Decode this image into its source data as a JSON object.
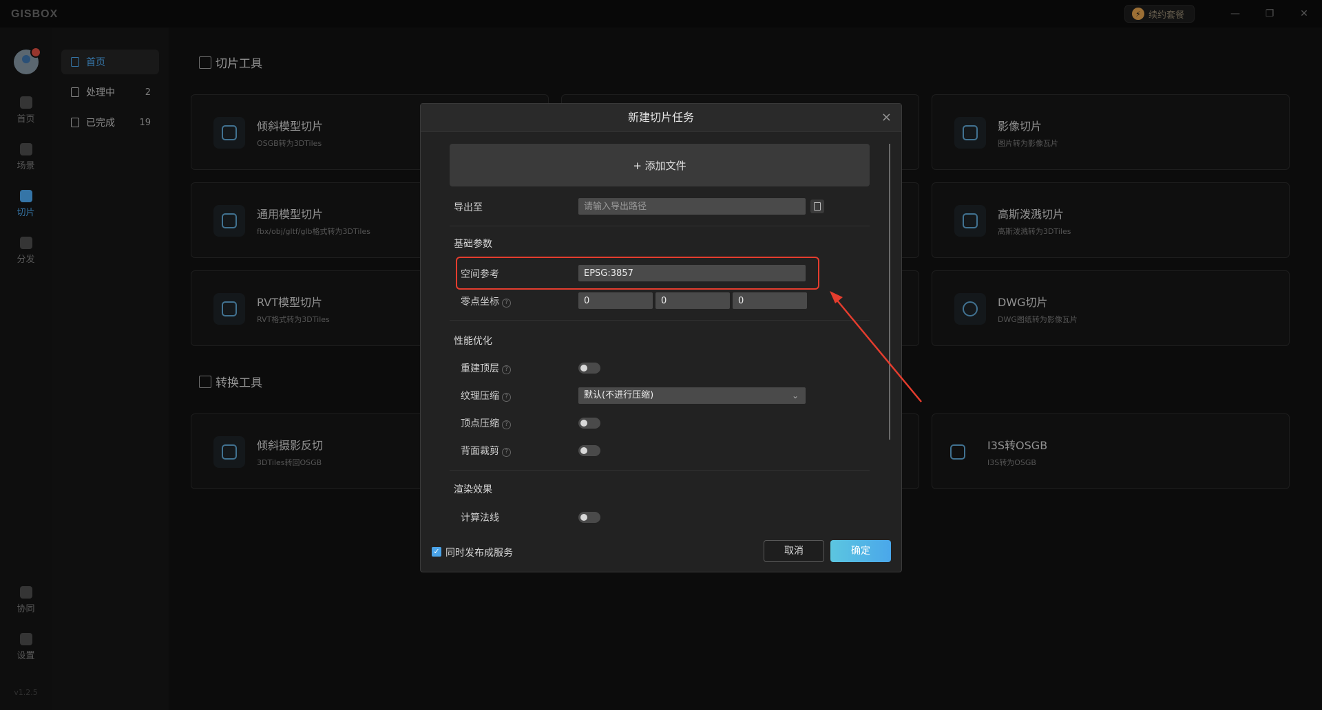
{
  "app": {
    "logo": "GISBOX",
    "renew_label": "续约套餐",
    "version": "v1.2.5"
  },
  "window_controls": {
    "minimize": "—",
    "maximize": "❐",
    "close": "✕"
  },
  "rail": {
    "items": [
      {
        "label": "首页"
      },
      {
        "label": "场景"
      },
      {
        "label": "切片"
      },
      {
        "label": "分发"
      },
      {
        "label": "协同"
      },
      {
        "label": "设置"
      }
    ],
    "active": "切片"
  },
  "subnav": {
    "items": [
      {
        "label": "首页",
        "count": ""
      },
      {
        "label": "处理中",
        "count": "2"
      },
      {
        "label": "已完成",
        "count": "19"
      }
    ]
  },
  "sections": {
    "slice_tools": "切片工具",
    "convert_tools": "转换工具"
  },
  "cards": {
    "oblique": {
      "title": "倾斜模型切片",
      "sub": "OSGB转为3DTiles"
    },
    "generic": {
      "title": "通用模型切片",
      "sub": "fbx/obj/gltf/glb格式转为3DTiles"
    },
    "rvt": {
      "title": "RVT模型切片",
      "sub": "RVT格式转为3DTiles"
    },
    "image": {
      "title": "影像切片",
      "sub": "图片转为影像瓦片"
    },
    "gaussian": {
      "title": "高斯泼溅切片",
      "sub": "高斯泼溅转为3DTiles"
    },
    "dwg": {
      "title": "DWG切片",
      "sub": "DWG图纸转为影像瓦片"
    },
    "reverse": {
      "title": "倾斜摄影反切",
      "sub": "3DTiles转回OSGB"
    },
    "i3s": {
      "title": "I3S转OSGB",
      "sub": "I3S转为OSGB"
    }
  },
  "dialog": {
    "title": "新建切片任务",
    "close": "×",
    "add_file": "+ 添加文件",
    "export_label": "导出至",
    "export_placeholder": "请输入导出路径",
    "basic_group": "基础参数",
    "spatial_ref_label": "空间参考",
    "spatial_ref_value": "EPSG:3857",
    "origin_label": "零点坐标",
    "origin_values": [
      "0",
      "0",
      "0"
    ],
    "perf_group": "性能优化",
    "rebuild_top_label": "重建顶层",
    "texture_label": "纹理压缩",
    "texture_value": "默认(不进行压缩)",
    "vertex_label": "顶点压缩",
    "backface_label": "背面裁剪",
    "render_group": "渲染效果",
    "normals_label": "计算法线",
    "publish_label": "同时发布成服务",
    "cancel": "取消",
    "ok": "确定"
  },
  "colors": {
    "accent": "#4aa3e8",
    "highlight": "#e53d2e"
  }
}
